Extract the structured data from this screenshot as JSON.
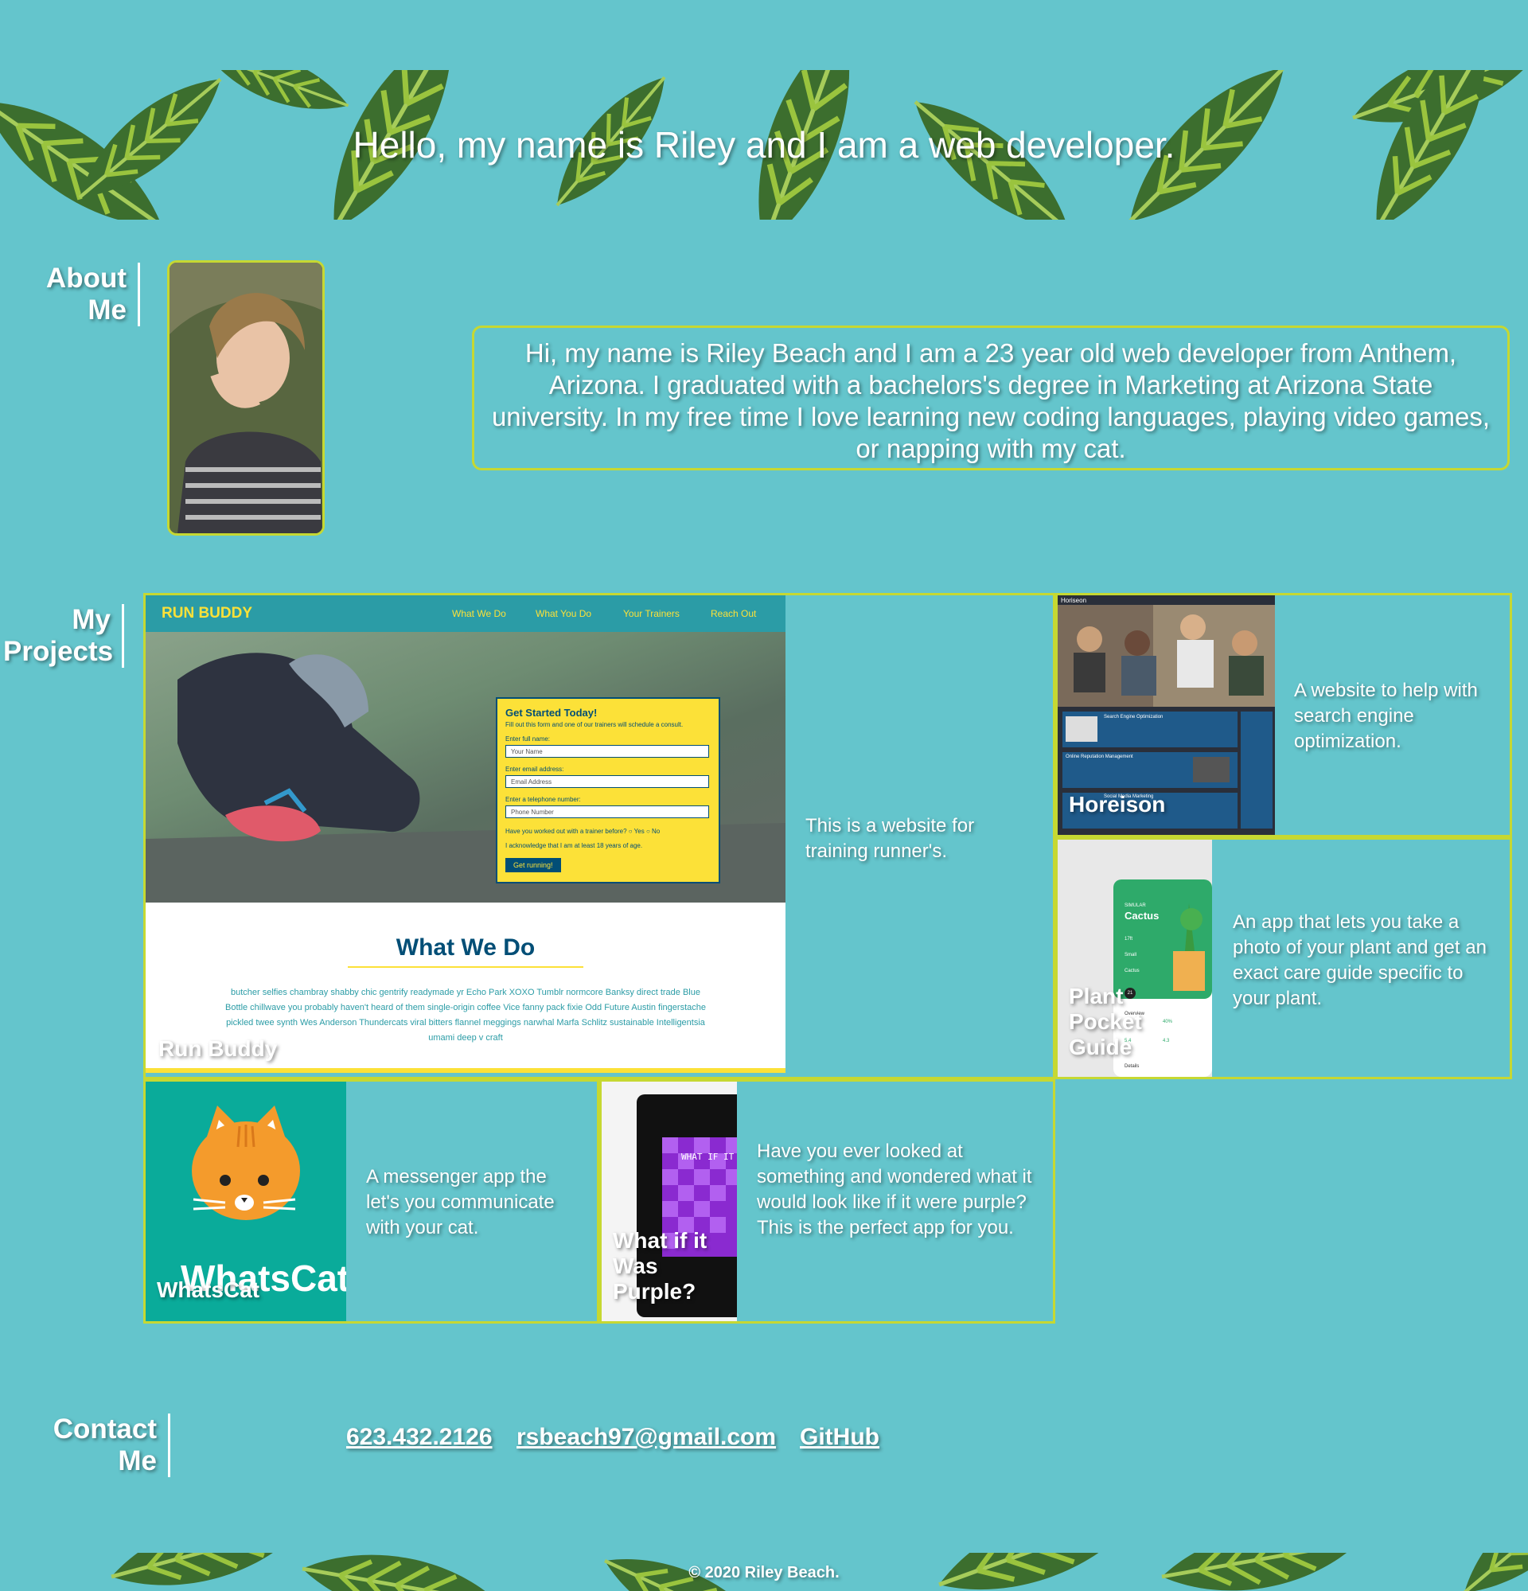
{
  "hero": {
    "title": "Hello, my name is Riley and I am a web developer."
  },
  "about": {
    "label": [
      "About",
      "Me"
    ],
    "photo_alt": "Photo of Riley",
    "bio": "Hi, my name is Riley Beach and I am a 23 year old web developer from Anthem, Arizona. I graduated with a bachelors's degree in Marketing at Arizona State university. In my free time I love learning new coding languages, playing video games, or napping with my cat."
  },
  "projects": {
    "label": [
      "My",
      "Projects"
    ],
    "run_buddy": {
      "title": "Run Buddy",
      "description": "This is a website for training runner's.",
      "mock": {
        "logo": "RUN BUDDY",
        "nav": [
          "What We Do",
          "What You Do",
          "Your Trainers",
          "Reach Out"
        ],
        "form_title": "Get Started Today!",
        "form_sub": "Fill out this form and one of our trainers will schedule a consult.",
        "label_name": "Enter full name:",
        "ph_name": "Your Name",
        "label_email": "Enter email address:",
        "ph_email": "Email Address",
        "label_phone": "Enter a telephone number:",
        "ph_phone": "Phone Number",
        "question": "Have you worked out with a trainer before?",
        "yes": "Yes",
        "no": "No",
        "ack": "I acknowledge that I am at least 18 years of age.",
        "button": "Get running!",
        "section_title": "What We Do",
        "section_text": "butcher selfies chambray shabby chic gentrify readymade yr Echo Park XOXO Tumblr normcore Banksy direct trade Blue Bottle chillwave you probably haven't heard of them single-origin coffee Vice fanny pack fixie Odd Future Austin fingerstache pickled twee synth Wes Anderson Thundercats viral bitters flannel meggings narwhal Marfa Schlitz sustainable Intelligentsia umami deep v craft"
      }
    },
    "horeison": {
      "title": "Horeison",
      "description": "A website to help with search engine optimization.",
      "mock": {
        "brand": "Horiseon",
        "rows": [
          "Search Engine Optimization",
          "Online Reputation Management",
          "Social Media Marketing"
        ]
      }
    },
    "plant": {
      "title": "Plant Pocket Guide",
      "description": "An app that lets you take a photo of your plant and get an exact care guide specific to your plant.",
      "mock": {
        "kicker": "SIMULAR",
        "plant_name": "Cactus",
        "rows": [
          "17ft",
          "Small",
          "Cactus"
        ],
        "badge": "21",
        "overview": "Overview",
        "stats": [
          "40%",
          "5.4",
          "4.3"
        ],
        "details": "Details"
      }
    },
    "whatscat": {
      "title": "WhatsCat",
      "logo_text": "WhatsCat",
      "description": "A messenger app the let's you communicate with your cat."
    },
    "purple": {
      "title": "What if it Was Purple?",
      "mock_text": "WHAT IF IT WAS PURPLE",
      "description": "Have you ever looked at something and wondered what it would look like if it were purple? This is the perfect app for you."
    }
  },
  "contact": {
    "label": [
      "Contact",
      "Me"
    ],
    "phone": "623.432.2126",
    "email": "rsbeach97@gmail.com",
    "github": "GitHub"
  },
  "footer": {
    "copyright": "© 2020 Riley Beach."
  },
  "colors": {
    "background": "#64c5cc",
    "accent": "#c6d832",
    "leaf_dark": "#3c6e2e",
    "leaf_light": "#8fc23c",
    "runbuddy_yellow": "#fce138",
    "runbuddy_blue": "#024e76"
  }
}
